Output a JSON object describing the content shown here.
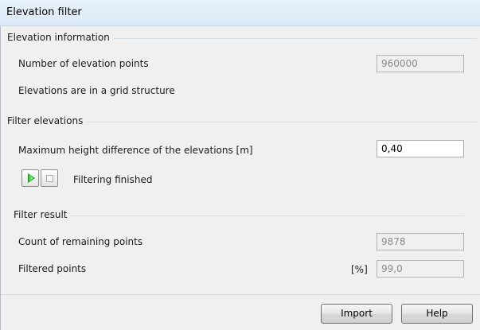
{
  "window": {
    "title": "Elevation filter"
  },
  "elevation_info": {
    "title": "Elevation information",
    "num_points_label": "Number of elevation points",
    "num_points_value": "960000",
    "grid_text": "Elevations are in a grid structure"
  },
  "filter": {
    "title": "Filter elevations",
    "max_height_label": "Maximum height difference of the elevations [m]",
    "max_height_value": "0,40",
    "status": "Filtering finished"
  },
  "result": {
    "title": "Filter result",
    "remaining_label": "Count of remaining points",
    "remaining_value": "9878",
    "filtered_label": "Filtered points",
    "filtered_unit": "[%]",
    "filtered_value": "99,0"
  },
  "buttons": {
    "import": "Import",
    "help": "Help"
  },
  "icons": {
    "start": "play-icon",
    "stop": "stop-icon"
  },
  "colors": {
    "play": "#1aa81a",
    "titlebar": "#dbe9f7"
  }
}
